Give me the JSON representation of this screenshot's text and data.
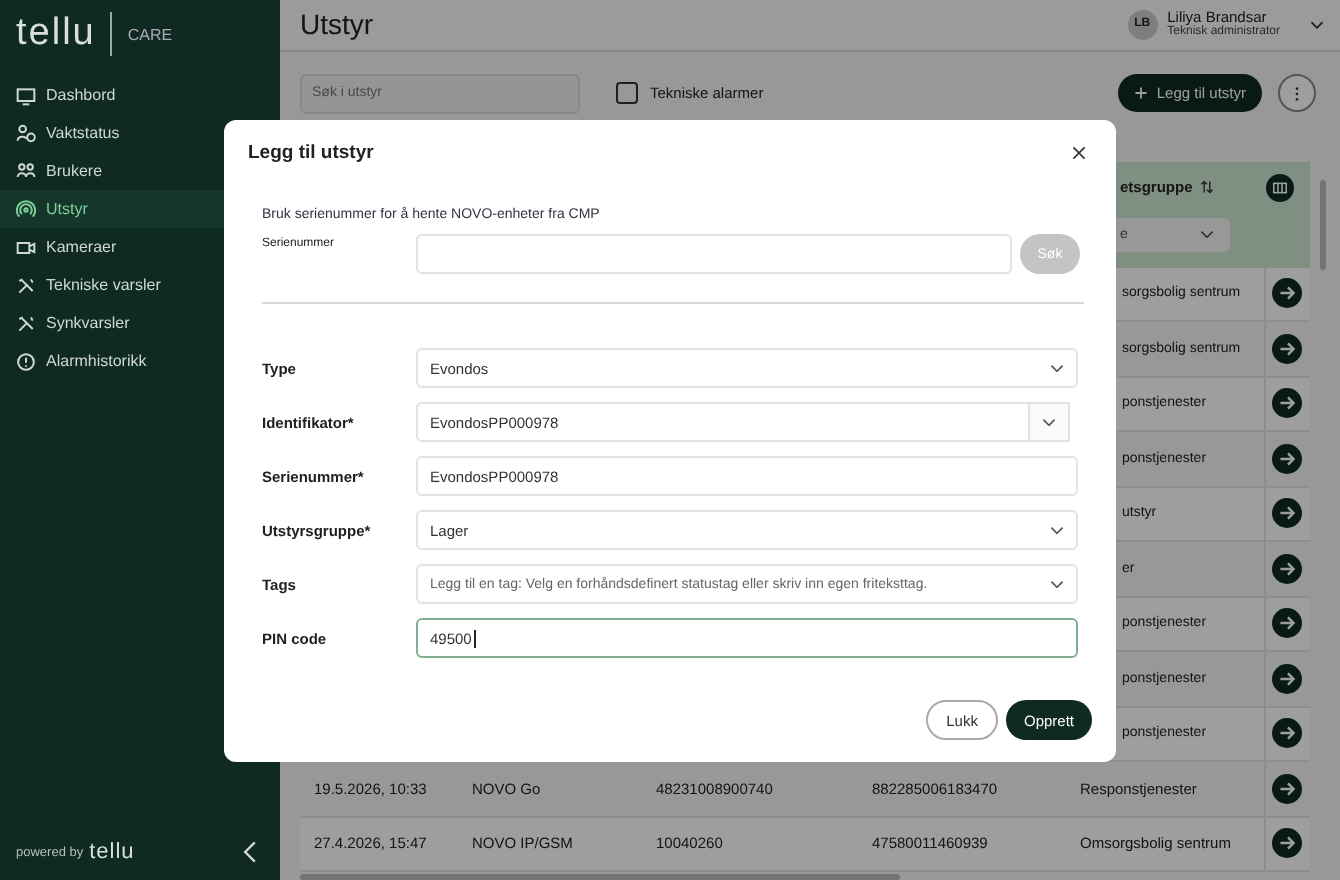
{
  "sidebar": {
    "logo": "tellu",
    "product": "CARE",
    "items": [
      {
        "label": "Dashbord",
        "selected": false
      },
      {
        "label": "Vaktstatus",
        "selected": false
      },
      {
        "label": "Brukere",
        "selected": false
      },
      {
        "label": "Utstyr",
        "selected": true
      },
      {
        "label": "Kameraer",
        "selected": false
      },
      {
        "label": "Tekniske varsler",
        "selected": false
      },
      {
        "label": "Synkvarsler",
        "selected": false
      },
      {
        "label": "Alarmhistorikk",
        "selected": false
      }
    ],
    "footer": {
      "powered_by": "powered by",
      "logo": "tellu"
    }
  },
  "header": {
    "title": "Utstyr",
    "user": {
      "initials": "LB",
      "name": "Liliya Brandsar",
      "role": "Teknisk administrator"
    }
  },
  "toolbar": {
    "search": {
      "placeholder": "Søk i utstyr"
    },
    "checkbox": {
      "label": "Tekniske alarmer",
      "checked": false
    },
    "add_button": "Legg til utstyr"
  },
  "table": {
    "columns": [
      {
        "label": "etsgruppe"
      }
    ],
    "filter": {
      "value": "e"
    },
    "rows": [
      {
        "kind": "partial",
        "cells": [
          "sorgsbolig sentrum"
        ]
      },
      {
        "kind": "partial",
        "cells": [
          "sorgsbolig sentrum"
        ]
      },
      {
        "kind": "partial",
        "cells": [
          "ponstjenester"
        ]
      },
      {
        "kind": "partial",
        "cells": [
          "ponstjenester"
        ]
      },
      {
        "kind": "partial",
        "cells": [
          "utstyr"
        ]
      },
      {
        "kind": "partial",
        "cells": [
          "er"
        ]
      },
      {
        "kind": "partial",
        "cells": [
          "ponstjenester"
        ]
      },
      {
        "kind": "partial",
        "cells": [
          "ponstjenester"
        ]
      },
      {
        "kind": "partial",
        "cells": [
          "ponstjenester"
        ]
      },
      {
        "kind": "full",
        "cells": [
          "19.5.2026, 10:33",
          "NOVO Go",
          "48231008900740",
          "882285006183470",
          "Responstjenester"
        ]
      },
      {
        "kind": "full",
        "cells": [
          "27.4.2026, 15:47",
          "NOVO IP/GSM",
          "10040260",
          "47580011460939",
          "Omsorgsbolig sentrum"
        ]
      }
    ]
  },
  "dialog": {
    "title": "Legg til utstyr",
    "hint": "Bruk serienummer for å hente NOVO-enheter fra CMP",
    "lookup": {
      "label": "Serienummer",
      "button": "Søk",
      "disabled": true
    },
    "fields": [
      {
        "kind": "select",
        "label": "Type",
        "value": "Evondos"
      },
      {
        "kind": "combo",
        "label": "Identifikator*",
        "value": "EvondosPP000978"
      },
      {
        "kind": "text",
        "label": "Serienummer*",
        "value": "EvondosPP000978"
      },
      {
        "kind": "select",
        "label": "Utstyrsgruppe*",
        "value": "Lager"
      },
      {
        "kind": "select",
        "label": "Tags",
        "placeholder": "Legg til en tag: Velg en forhåndsdefinert statustag eller skriv inn egen friteksttag."
      },
      {
        "kind": "text",
        "label": "PIN code",
        "value": "49500",
        "focused": true
      }
    ],
    "buttons": [
      {
        "kind": "secondary",
        "label": "Lukk"
      },
      {
        "kind": "primary",
        "label": "Opprett"
      }
    ]
  }
}
